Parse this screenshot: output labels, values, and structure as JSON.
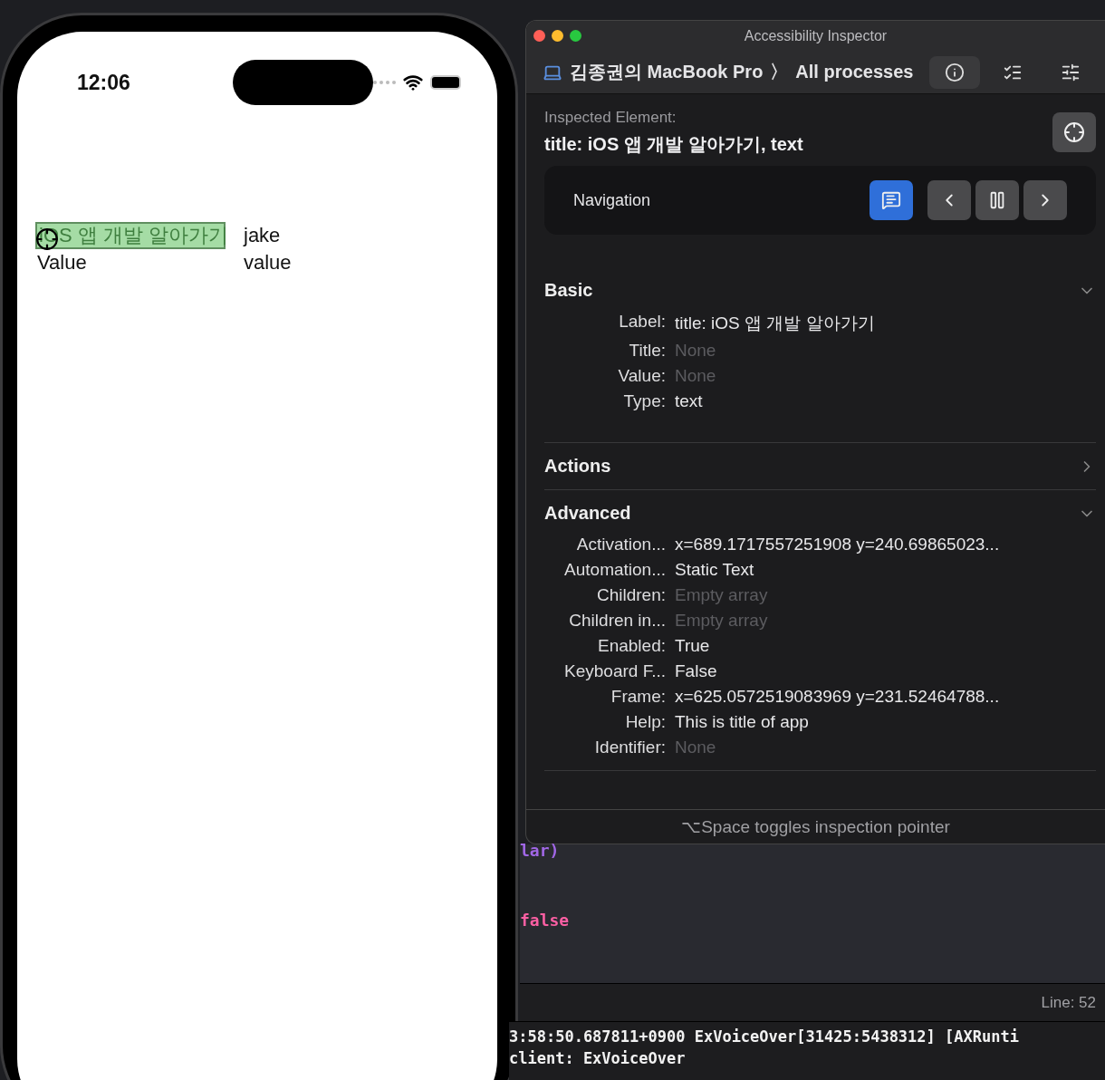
{
  "phone": {
    "time": "12:06",
    "rows": [
      {
        "left": "iOS 앱 개발 알아가기",
        "right": "jake",
        "highlighted": true
      },
      {
        "left": "Value",
        "right": "value",
        "highlighted": false
      }
    ]
  },
  "inspector": {
    "title": "Accessibility Inspector",
    "device": "김종권의 MacBook Pro",
    "separator": "〉",
    "process": "All processes",
    "toolbar": [
      {
        "kind": "info",
        "selected": true
      },
      {
        "kind": "list",
        "selected": false
      },
      {
        "kind": "settings",
        "selected": false
      }
    ],
    "inspected_label": "Inspected Element:",
    "inspected_value": "title: iOS 앱 개발 알아가기, text",
    "navigation": {
      "label": "Navigation",
      "buttons": [
        {
          "kind": "speak",
          "selected": true
        },
        {
          "kind": "previous",
          "selected": false
        },
        {
          "kind": "pause",
          "selected": false
        },
        {
          "kind": "next",
          "selected": false
        }
      ]
    },
    "sections": [
      {
        "title": "Basic",
        "expanded": true,
        "rows": [
          {
            "label": "Label:",
            "value": "title: iOS 앱 개발 알아가기",
            "muted": false
          },
          {
            "label": "Title:",
            "value": "None",
            "muted": true
          },
          {
            "label": "Value:",
            "value": "None",
            "muted": true
          },
          {
            "label": "Type:",
            "value": "text",
            "muted": false
          }
        ]
      },
      {
        "title": "Actions",
        "expanded": false
      },
      {
        "title": "Advanced",
        "expanded": true,
        "rows": [
          {
            "label": "Activation...",
            "value": "x=689.1717557251908 y=240.69865023...",
            "muted": false
          },
          {
            "label": "Automation...",
            "value": "Static Text",
            "muted": false
          },
          {
            "label": "Children:",
            "value": "Empty array",
            "muted": true
          },
          {
            "label": "Children in...",
            "value": "Empty array",
            "muted": true
          },
          {
            "label": "Enabled:",
            "value": "True",
            "muted": false
          },
          {
            "label": "Keyboard F...",
            "value": "False",
            "muted": false
          },
          {
            "label": "Frame:",
            "value": "x=625.0572519083969 y=231.52464788...",
            "muted": false
          },
          {
            "label": "Help:",
            "value": "This is title of app",
            "muted": false
          },
          {
            "label": "Identifier:",
            "value": "None",
            "muted": true
          }
        ]
      }
    ],
    "footer": "⌥Space toggles inspection pointer"
  },
  "editor": {
    "lines": [
      {
        "text": "lar)",
        "kind": "type"
      },
      {
        "text": "false",
        "kind": "keyword"
      }
    ],
    "status": "Line: 52"
  },
  "console": [
    "3:58:50.687811+0900 ExVoiceOver[31425:5438312] [AXRunti",
    "client: ExVoiceOver"
  ]
}
